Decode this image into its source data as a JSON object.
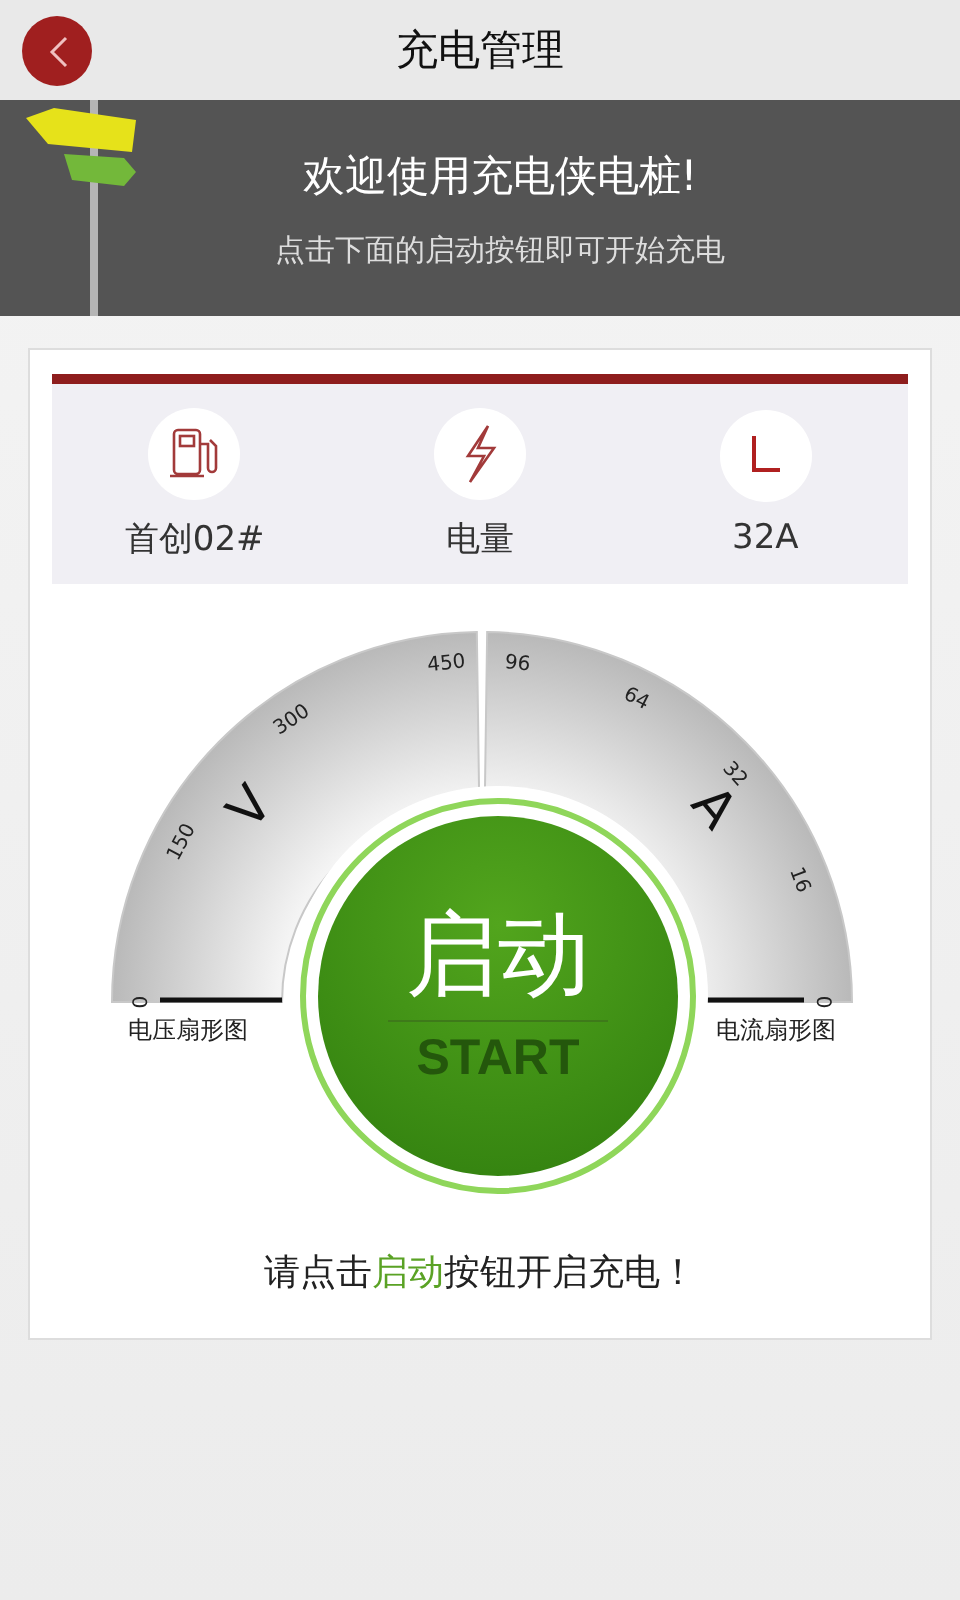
{
  "header": {
    "title": "充电管理"
  },
  "banner": {
    "title": "欢迎使用充电侠电桩!",
    "subtitle": "点击下面的启动按钮即可开始充电"
  },
  "info": [
    {
      "kind": "pump",
      "label": "首创02#"
    },
    {
      "kind": "bolt",
      "label": "电量"
    },
    {
      "kind": "clock",
      "label": "32A"
    }
  ],
  "gauges": [
    {
      "unit": "V",
      "caption": "电压扇形图",
      "ticks": [
        "0",
        "150",
        "300",
        "450"
      ]
    },
    {
      "unit": "A",
      "caption": "电流扇形图",
      "ticks": [
        "96",
        "64",
        "32",
        "16",
        "0"
      ]
    }
  ],
  "start": {
    "label": "启动",
    "sublabel": "START"
  },
  "hint": "请点击**启动**按钮开启充电！"
}
